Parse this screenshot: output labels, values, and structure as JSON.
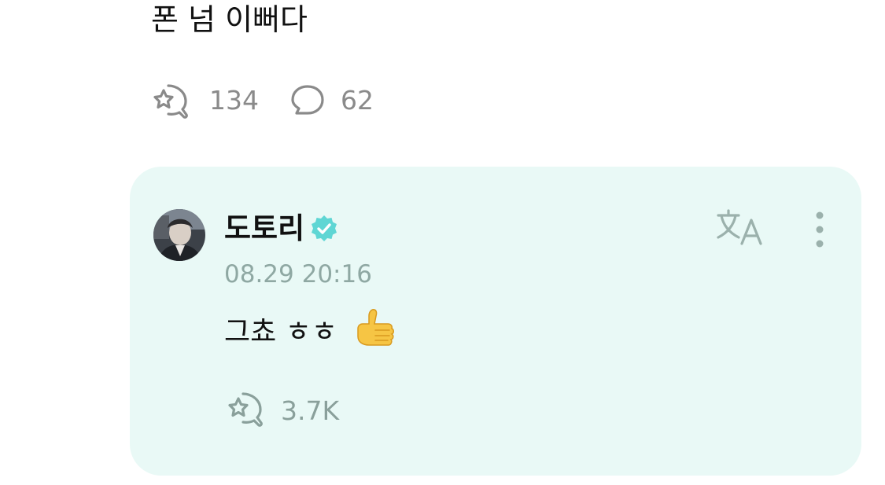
{
  "post": {
    "text": "폰 넘 이뻐다",
    "like_count": "134",
    "comment_count": "62",
    "icons": {
      "like": "star-speech-icon",
      "comment": "speech-bubble-icon"
    }
  },
  "reply": {
    "author": "도토리",
    "verified_icon": "verified-badge-icon",
    "timestamp": "08.29 20:16",
    "text": "그쵸 ㅎㅎ",
    "emoji_icon": "thumbs-up-icon",
    "like_count": "3.7K",
    "actions": {
      "translate_icon": "translate-icon",
      "more_icon": "more-vertical-icon"
    }
  },
  "colors": {
    "card_background": "#e9f9f6",
    "muted_text": "#8a8a8a",
    "timestamp_text": "#8fa8a3",
    "verified_badge": "#5fd6d4",
    "icon_tint": "#9bb1ac"
  }
}
